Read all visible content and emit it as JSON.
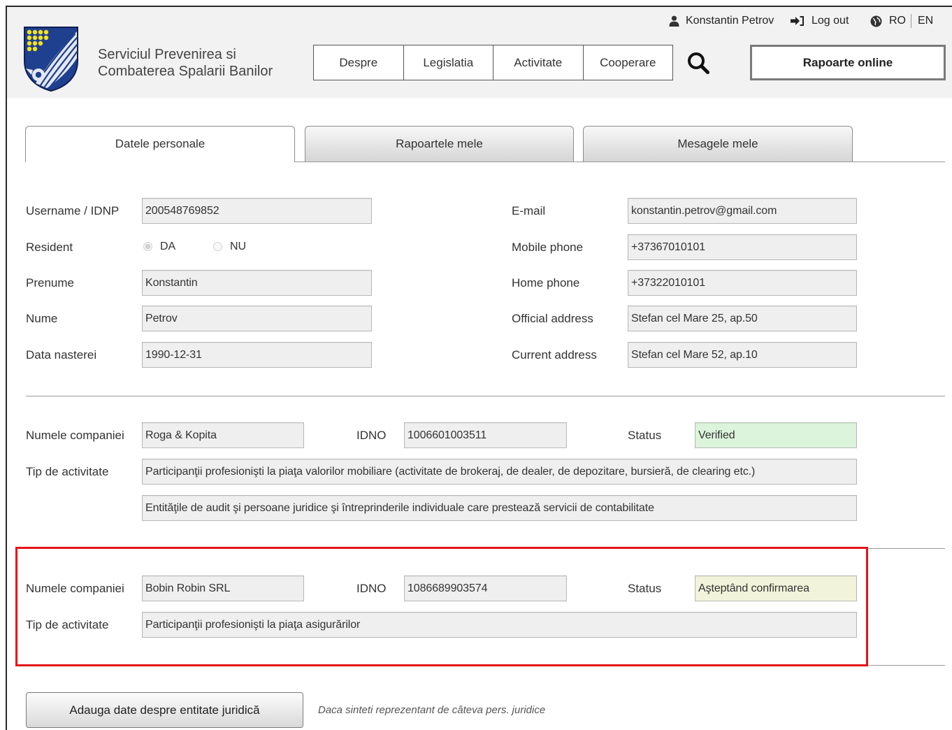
{
  "header": {
    "org_name": [
      "Serviciul Prevenirea si",
      "Combaterea Spalarii Banilor"
    ],
    "user": {
      "name": "Konstantin Petrov",
      "icon": "user-icon"
    },
    "logout": {
      "label": "Log out",
      "icon": "logout-icon"
    },
    "language": {
      "icon": "globe-icon",
      "options": [
        {
          "label": "RO",
          "active": true
        },
        {
          "label": "EN",
          "active": false
        }
      ]
    },
    "nav": [
      "Despre",
      "Legislatia",
      "Activitate",
      "Cooperare"
    ],
    "search_icon": "search-icon",
    "reports_button": "Rapoarte online"
  },
  "tabs": [
    {
      "label": "Datele personale",
      "active": true
    },
    {
      "label": "Rapoartele mele",
      "active": false
    },
    {
      "label": "Mesagele mele",
      "active": false
    }
  ],
  "personal": {
    "username": {
      "label": "Username / IDNP",
      "value": "200548769852"
    },
    "resident": {
      "label": "Resident",
      "options": [
        {
          "label": "DA",
          "checked": true
        },
        {
          "label": "NU",
          "checked": false
        }
      ]
    },
    "first_name": {
      "label": "Prenume",
      "value": "Konstantin"
    },
    "last_name": {
      "label": "Nume",
      "value": "Petrov"
    },
    "birth_date": {
      "label": "Data nasterei",
      "value": "1990-12-31"
    },
    "email": {
      "label": "E-mail",
      "value": "konstantin.petrov@gmail.com"
    },
    "mobile_phone": {
      "label": "Mobile phone",
      "value": "+37367010101"
    },
    "home_phone": {
      "label": "Home phone",
      "value": "+37322010101"
    },
    "official_address": {
      "label": "Official address",
      "value": "Stefan cel Mare 25, ap.50"
    },
    "current_address": {
      "label": "Current address",
      "value": "Stefan cel Mare 52, ap.10"
    }
  },
  "companies": [
    {
      "name_label": "Numele companiei",
      "name": "Roga & Kopita",
      "idno_label": "IDNO",
      "idno": "1006601003511",
      "status_label": "Status",
      "status": "Verified",
      "status_color": "#dcf4dc",
      "activity_label": "Tip de activitate",
      "activities": [
        "Participanţii profesionişti la piaţa valorilor mobiliare (activitate de brokeraj, de dealer, de depozitare, bursieră, de clearing etc.)",
        "Entităţile de audit şi persoane juridice şi întreprinderile individuale care prestează servicii de contabilitate"
      ],
      "highlighted": false
    },
    {
      "name_label": "Numele companiei",
      "name": "Bobin Robin SRL",
      "idno_label": "IDNO",
      "idno": "1086689903574",
      "status_label": "Status",
      "status": "Aşteptând confirmarea",
      "status_color": "#f1f3da",
      "activity_label": "Tip de activitate",
      "activities": [
        "Participanţii profesionişti la piaţa asigurărilor"
      ],
      "highlighted": true
    }
  ],
  "add_entity_button": "Adauga date despre entitate juridică",
  "add_entity_hint": "Daca sinteti reprezentant de câteva pers. juridice",
  "colors": {
    "header_bg": "#f2f2f2",
    "highlight_border": "#e3141b",
    "logo_shield": "#1f3f8f",
    "logo_dots": "#f5e21c"
  }
}
